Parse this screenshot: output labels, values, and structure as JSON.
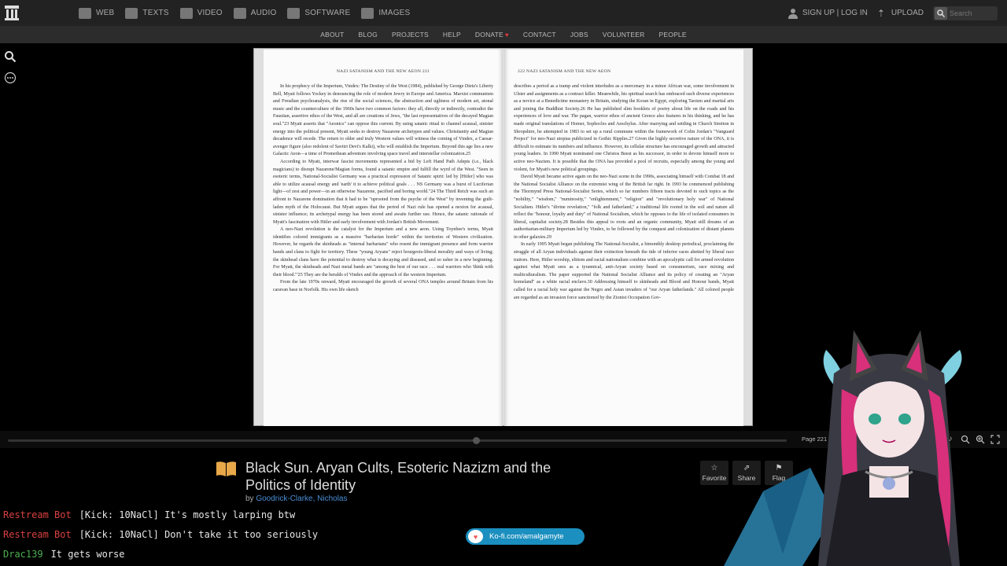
{
  "nav": {
    "media": [
      {
        "label": "WEB",
        "icon": "web-icon"
      },
      {
        "label": "TEXTS",
        "icon": "texts-icon"
      },
      {
        "label": "VIDEO",
        "icon": "video-icon"
      },
      {
        "label": "AUDIO",
        "icon": "audio-icon"
      },
      {
        "label": "SOFTWARE",
        "icon": "software-icon"
      },
      {
        "label": "IMAGES",
        "icon": "images-icon"
      }
    ],
    "signup": "SIGN UP | LOG IN",
    "upload": "UPLOAD",
    "search_placeholder": "Search"
  },
  "subnav": [
    "ABOUT",
    "BLOG",
    "PROJECTS",
    "HELP",
    "DONATE",
    "CONTACT",
    "JOBS",
    "VOLUNTEER",
    "PEOPLE"
  ],
  "book": {
    "left_header": "NAZI SATANISM AND THE NEW AEON   221",
    "right_header": "222   NAZI SATANISM AND THE NEW AEON",
    "left_paragraphs": [
      "In his prophecy of the Imperium, Vindex: The Destiny of the West (1984), published by George Dietz's Liberty Bell, Myatt follows Yockey in denouncing the role of modern Jewry in Europe and America. Marxist communism and Freudian psychoanalysis, the rise of the social sciences, the abstraction and ugliness of modern art, atonal music and the counterculture of the 1960s have two common factors: they all, directly or indirectly, contradict the Faustian, assertive ethos of the West, and all are creations of Jews, \"the last representatives of the decayed Magian soul.\"23 Myatt asserts that \"Aeonics\" can oppose this current. By using satanic ritual to channel acausal, sinister energy into the political present, Myatt seeks to destroy Nazarene archetypes and values. Christianity and Magian decadence will recede. The return to older and truly Western values will witness the coming of Vindex, a Caesar-avenger figure (also redolent of Savitri Devi's Kalki), who will establish the Imperium. Beyond this age lies a new Galactic Aeon—a time of Promethean adventure involving space travel and interstellar colonization.25",
      "According to Myatt, interwar fascist movements represented a bid by Left Hand Path Adepts (i.e., black magicians) to disrupt Nazarene/Magian forms, found a satanic empire and fulfill the wyrd of the West. \"Seen in esoteric terms, National-Socialist Germany was a practical expression of Satanic spirit: led by [Hitler] who was able to utilize acausal energy and 'earth' it to achieve political goals . . . NS Germany was a burst of Luciferian light—of zest and power—in an otherwise Nazarene, pacified and boring world.\"24 The Third Reich was such an affront to Nazarene domination that it had to be \"uprooted from the psyche of the West\" by inventing the guilt-laden myth of the Holocaust. But Myatt argues that the period of Nazi rule has opened a nexion for acausal, sinister influence; its archetypal energy has been stored and awaits further use. Hence, the satanic rationale of Myatt's fascination with Hitler and early involvement with Jordan's British Movement.",
      "A neo-Nazi revolution is the catalyst for the Imperium and a new aeon. Using Toynbee's terms, Myatt identifies colored immigrants as a massive \"barbarian horde\" within the territories of Western civilization. However, he regards the skinheads as \"internal barbarians\" who resent the immigrant presence and form warrior bands and clans to fight for territory. These \"young Aryans\" reject bourgeois-liberal morality and ways of living; the skinhead clans have the potential to destroy what is decaying and diseased, and so usher in a new beginning. For Myatt, the skinheads and Nazi metal bands are \"among the best of our race . . . real warriors who 'think with their blood.'\"25 They are the heralds of Vindex and the approach of the western Imperium.",
      "From the late 1970s onward, Myatt encouraged the growth of several ONA temples around Britain from his caravan base in Norfolk. His own life sketch"
    ],
    "right_paragraphs": [
      "describes a period as a tramp and violent interludes as a mercenary in a minor African war, some involvement in Ulster and assignments as a contract killer. Meanwhile, his spiritual search has embraced such diverse experiences as a novice at a Benedictine monastery in Britain, studying the Koran in Egypt, exploring Taoism and martial arts and joining the Buddhist Society.26 He has published slim booklets of poetry about life on the roads and his experiences of love and war. The pagan, warrior ethos of ancient Greece also features in his thinking, and he has made original translations of Homer, Sophocles and Aeschylus. After marrying and settling in Church Stretton in Shropshire, he attempted in 1983 to set up a rural commune within the framework of Colin Jordan's \"Vanguard Project\" for neo-Nazi utopias publicized in Gothic Ripples.27 Given the highly secretive nature of the ONA, it is difficult to estimate its numbers and influence. However, its cellular structure has encouraged growth and attracted young leaders. In 1990 Myatt nominated one Christos Beest as his successor, in order to devote himself more to active neo-Nazism. It is possible that the ONA has provided a pool of recruits, especially among the young and violent, for Myatt's new political groupings.",
      "David Myatt became active again on the neo-Nazi scene in the 1990s, associating himself with Combat 18 and the National Socialist Alliance on the extremist wing of the British far right. In 1993 he commenced publishing the Thormynd Press National-Socialist Series, which so far numbers fifteen tracts devoted to such topics as the \"nobility,\" \"wisdom,\" \"numinosity,\" \"enlightenment,\" \"religion\" and \"revolutionary holy war\" of National Socialism. Hitler's \"divine revelation,\" \"folk and fatherland,\" a traditional life rooted in the soil and nature all reflect the \"honour, loyalty and duty\" of National Socialism, which he opposes to the life of isolated consumers in liberal, capitalist society.28 Besides this appeal to roots and an organic community, Myatt still dreams of an authoritarian-military Imperium led by Vindex, to be followed by the conquest and colonization of distant planets in other galaxies.29",
      "In early 1995 Myatt began publishing The National-Socialist, a bimonthly desktop periodical, proclaiming the struggle of all Aryan individuals against their extinction beneath the tide of inferior races abetted by liberal race traitors. Here, Hitler worship, elitism and racial nationalism combine with an apocalyptic call for armed revolution against what Myatt sees as a tyrannical, anti-Aryan society based on consumerism, race mixing and multiculturalism. The paper supported the National Socialist Alliance and its policy of creating an \"Aryan homeland\" as a white racial enclave.30 Addressing himself to skinheads and Blood and Honour bands, Myatt called for a racial holy war against the Negro and Asian invaders of \"our Aryan fatherlands.\" All colored people are regarded as an invasion force sanctioned by the Zionist Occupation Gov-"
    ]
  },
  "reader": {
    "page_count": "Page 221 (228/"
  },
  "item": {
    "title": "Black Sun. Aryan Cults, Esoteric Nazizm and the Politics of Identity",
    "by_prefix": "by",
    "author": "Goodrick-Clarke, Nicholas",
    "actions": [
      {
        "label": "Favorite",
        "glyph": "☆"
      },
      {
        "label": "Share",
        "glyph": "⇗"
      },
      {
        "label": "Flag",
        "glyph": "⚑"
      }
    ]
  },
  "chat": [
    {
      "user": "Restream Bot",
      "text": "[Kick: 10NaCl] It's mostly larping btw",
      "color": "#d94040"
    },
    {
      "user": "Restream Bot",
      "text": "[Kick: 10NaCl] Don't take it too seriously",
      "color": "#d94040"
    },
    {
      "user": "Drac139",
      "text": "It gets worse",
      "color": "#4caf50"
    }
  ],
  "kofi": {
    "label": "Ko-fi.com/amalgamyte"
  }
}
